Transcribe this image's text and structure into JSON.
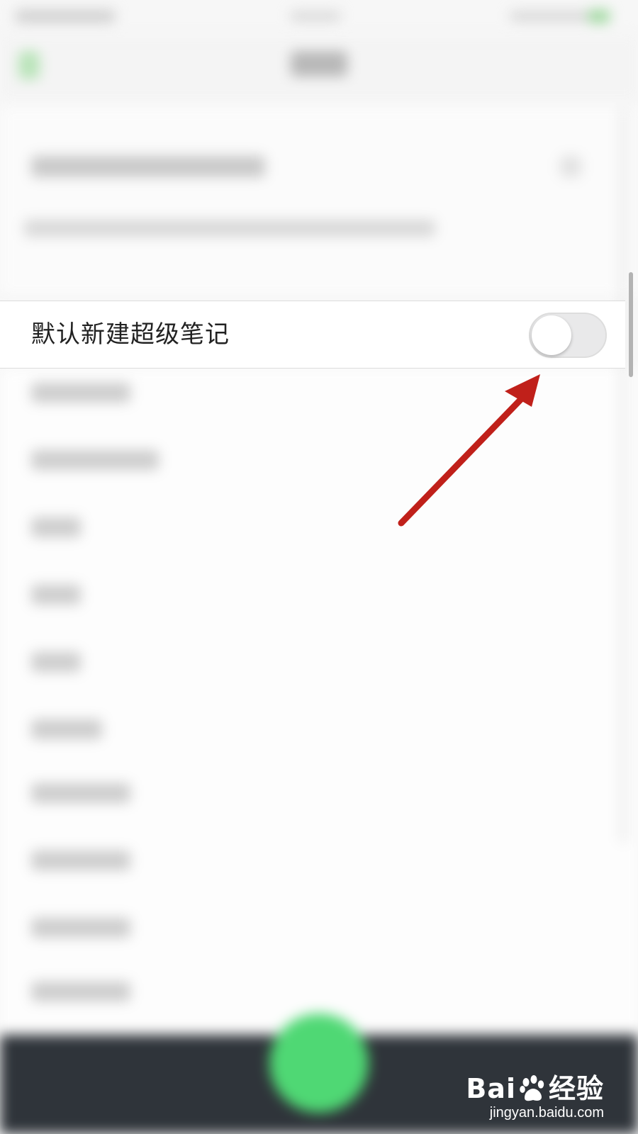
{
  "settings": {
    "focused_row": {
      "label": "默认新建超级笔记",
      "toggle_on": false
    }
  },
  "watermark": {
    "brand_left": "Bai",
    "brand_right": "经验",
    "url": "jingyan.baidu.com"
  },
  "annotation": {
    "arrow_color": "#c0201a"
  },
  "colors": {
    "accent_green": "#4fd874",
    "bottom_bar": "#2f343a"
  }
}
